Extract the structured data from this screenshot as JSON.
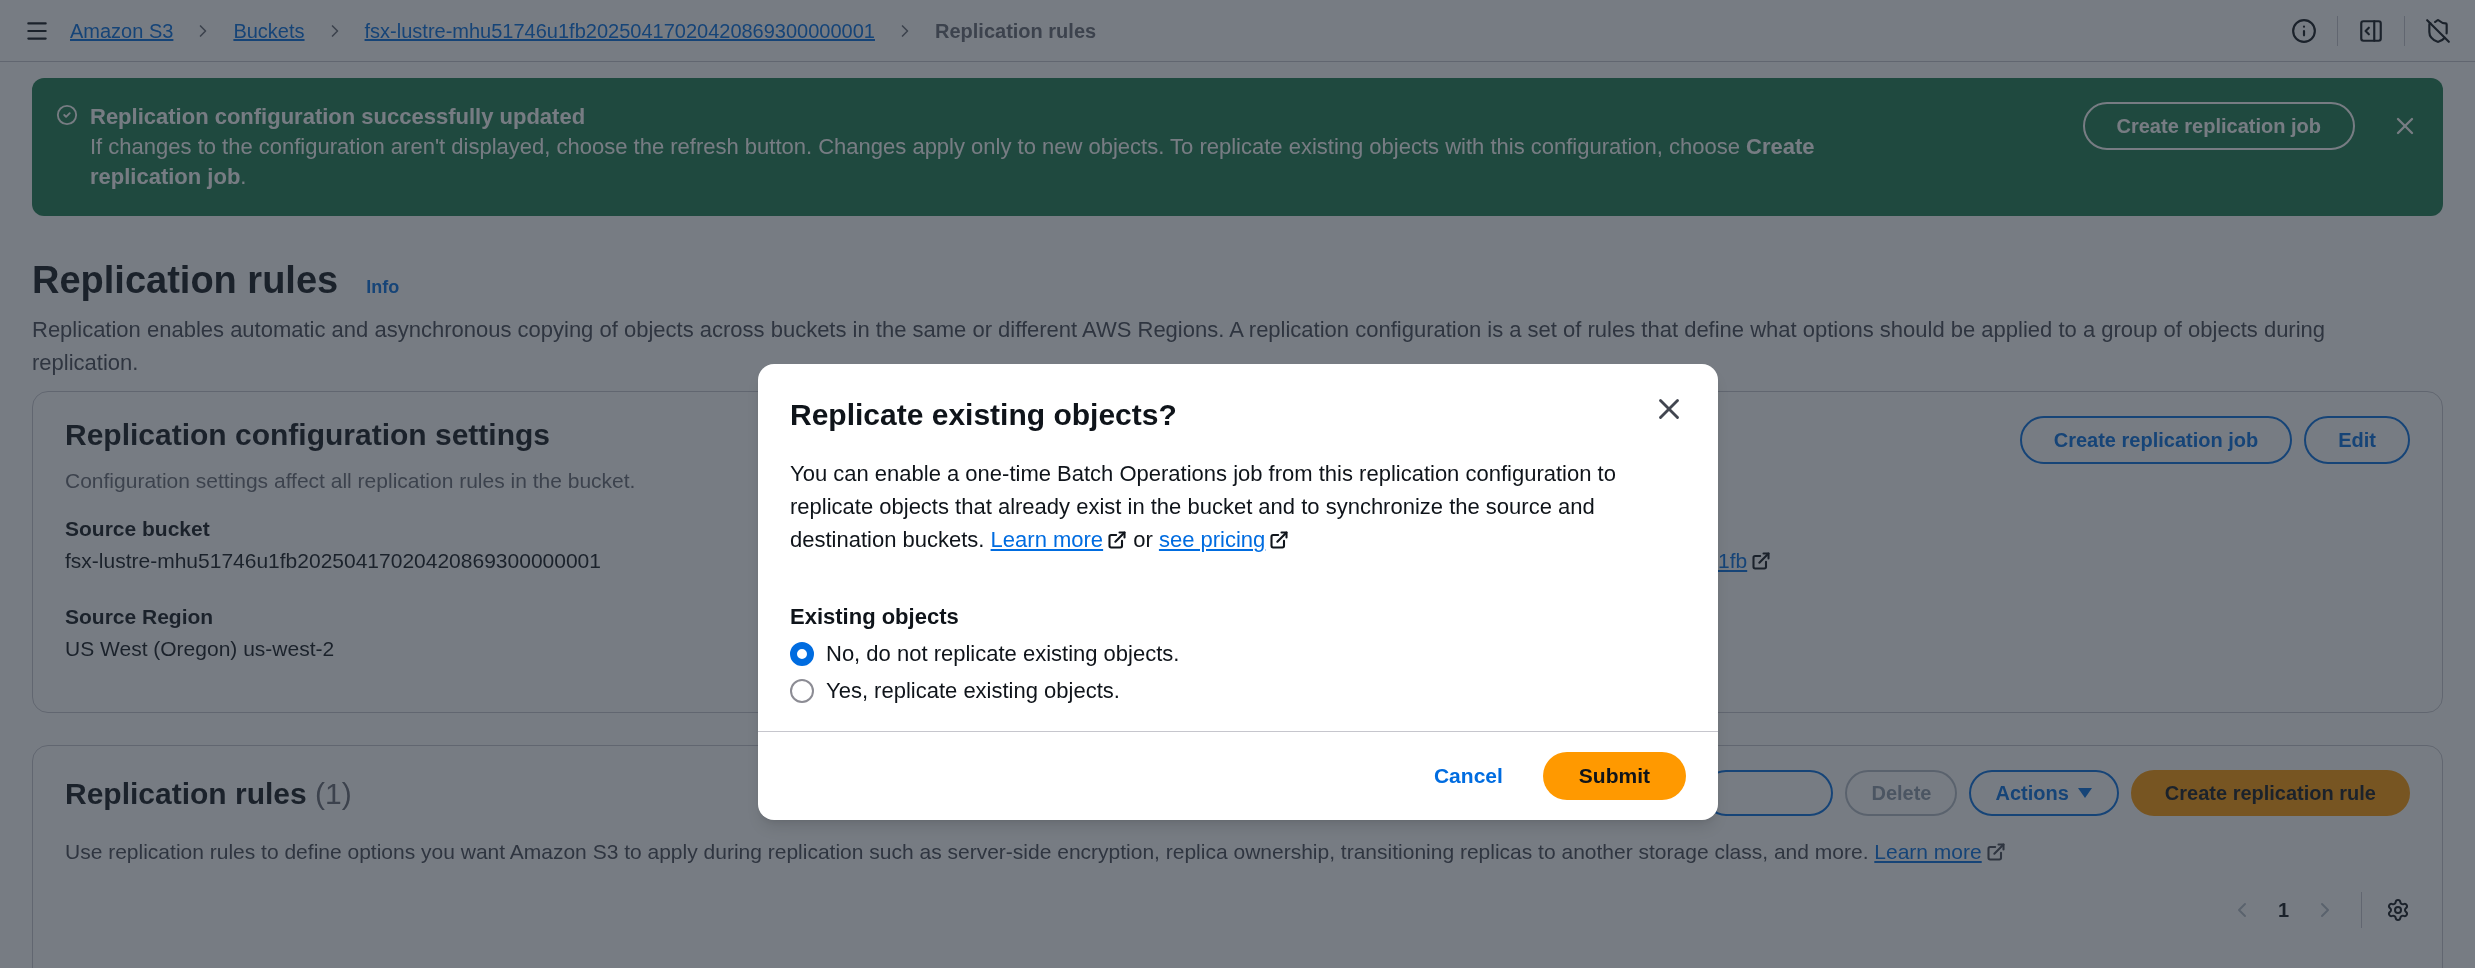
{
  "breadcrumbs": [
    {
      "label": "Amazon S3",
      "kind": "link"
    },
    {
      "label": "Buckets",
      "kind": "link"
    },
    {
      "label": "fsx-lustre-mhu51746u1fb20250417020420869300000001",
      "kind": "link"
    },
    {
      "label": "Replication rules",
      "kind": "current"
    }
  ],
  "flash": {
    "kind": "success",
    "title": "Replication configuration successfully updated",
    "message": "If changes to the configuration aren't displayed, choose the refresh button. Changes apply only to new objects. To replicate existing objects with this configuration, choose **Create replication job**.",
    "button": "Create replication job"
  },
  "page": {
    "title": "Replication rules",
    "info": "Info",
    "description": "Replication enables automatic and asynchronous copying of objects across buckets in the same or different AWS Regions. A replication configuration is a set of rules that define what options should be applied to a group of objects during replication."
  },
  "settings": {
    "title": "Replication configuration settings",
    "description": "Configuration settings affect all replication rules in the bucket.",
    "buttons": [
      "Create replication job",
      "Edit"
    ],
    "fields": [
      {
        "label": "Source bucket",
        "value": "fsx-lustre-mhu51746u1fb20250417020420869300000001"
      },
      {
        "label": "Source Region",
        "value": "US West (Oregon) us-west-2"
      }
    ],
    "destination_link": "1fb"
  },
  "rules": {
    "title": "Replication rules",
    "count": "(1)",
    "description": "Use replication rules to define options you want Amazon S3 to apply during replication such as server-side encryption, replica ownership, transitioning replicas to another storage class, and more.",
    "learn_more": "Learn more",
    "buttons": [
      {
        "kind": "normal",
        "label": "Delete",
        "disabled": true
      },
      {
        "kind": "dropdown",
        "label": "Actions",
        "disabled": false
      },
      {
        "kind": "primary",
        "label": "Create replication rule",
        "disabled": false
      }
    ],
    "page": "1"
  },
  "modal": {
    "title": "Replicate existing objects?",
    "body": "You can enable a one-time Batch Operations job from this replication configuration to replicate objects that already exist in the bucket and to synchronize the source and destination buckets.",
    "learn_more": "Learn more",
    "or": "or",
    "pricing": "see pricing",
    "group_label": "Existing objects",
    "options": [
      {
        "label": "No, do not replicate existing objects.",
        "selected": true
      },
      {
        "label": "Yes, replicate existing objects.",
        "selected": false
      }
    ],
    "cancel": "Cancel",
    "submit": "Submit"
  }
}
